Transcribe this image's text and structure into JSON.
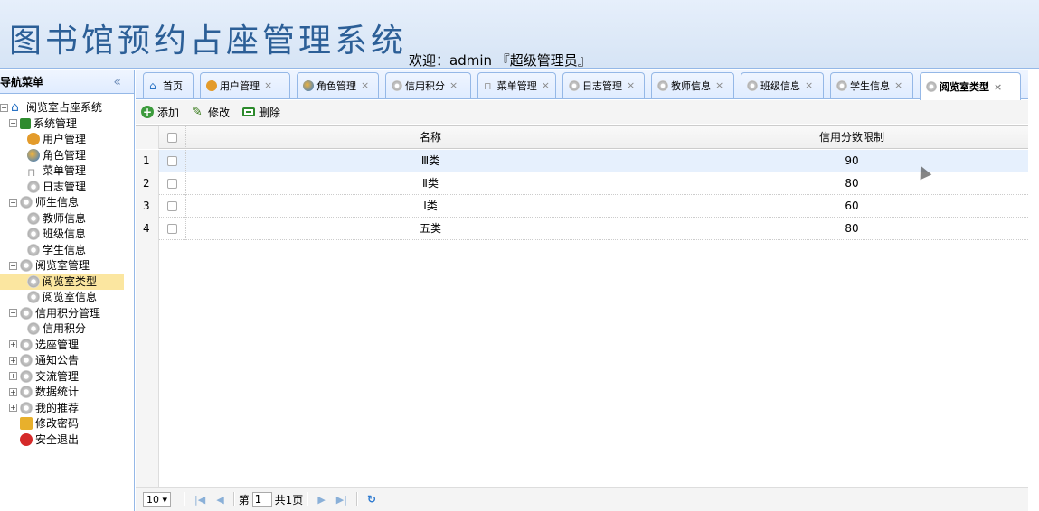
{
  "header": {
    "title": "图书馆预约占座管理系统",
    "welcome": "欢迎：admin 『超级管理员』"
  },
  "nav": {
    "title": "导航菜单",
    "collapse_icon": "«",
    "root": "阅览室占座系统",
    "items": [
      {
        "label": "系统管理",
        "level": 1
      },
      {
        "label": "用户管理",
        "level": 2
      },
      {
        "label": "角色管理",
        "level": 2
      },
      {
        "label": "菜单管理",
        "level": 2
      },
      {
        "label": "日志管理",
        "level": 2
      },
      {
        "label": "师生信息",
        "level": 1
      },
      {
        "label": "教师信息",
        "level": 2
      },
      {
        "label": "班级信息",
        "level": 2
      },
      {
        "label": "学生信息",
        "level": 2
      },
      {
        "label": "阅览室管理",
        "level": 1
      },
      {
        "label": "阅览室类型",
        "level": 2,
        "selected": true
      },
      {
        "label": "阅览室信息",
        "level": 2
      },
      {
        "label": "信用积分管理",
        "level": 1
      },
      {
        "label": "信用积分",
        "level": 2
      },
      {
        "label": "选座管理",
        "level": 1
      },
      {
        "label": "通知公告",
        "level": 1
      },
      {
        "label": "交流管理",
        "level": 1
      },
      {
        "label": "数据统计",
        "level": 1
      },
      {
        "label": "我的推荐",
        "level": 1
      },
      {
        "label": "修改密码",
        "level": 1
      },
      {
        "label": "安全退出",
        "level": 1
      }
    ]
  },
  "tabs": [
    {
      "label": "首页",
      "closable": false
    },
    {
      "label": "用户管理",
      "closable": true
    },
    {
      "label": "角色管理",
      "closable": true
    },
    {
      "label": "信用积分",
      "closable": true
    },
    {
      "label": "菜单管理",
      "closable": true
    },
    {
      "label": "日志管理",
      "closable": true
    },
    {
      "label": "教师信息",
      "closable": true
    },
    {
      "label": "班级信息",
      "closable": true
    },
    {
      "label": "学生信息",
      "closable": true
    },
    {
      "label": "阅览室类型",
      "closable": true,
      "active": true
    }
  ],
  "close_glyph": "×",
  "toolbar": {
    "add": "添加",
    "edit": "修改",
    "delete": "删除"
  },
  "grid": {
    "columns": [
      "名称",
      "信用分数限制"
    ],
    "rows": [
      {
        "num": "1",
        "name": "Ⅲ类",
        "limit": "90"
      },
      {
        "num": "2",
        "name": "Ⅱ类",
        "limit": "80"
      },
      {
        "num": "3",
        "name": "Ⅰ类",
        "limit": "60"
      },
      {
        "num": "4",
        "name": "五类",
        "limit": "80"
      }
    ]
  },
  "pager": {
    "page_size": "10 ▾",
    "page_prefix": "第",
    "page_value": "1",
    "total": "共1页"
  }
}
